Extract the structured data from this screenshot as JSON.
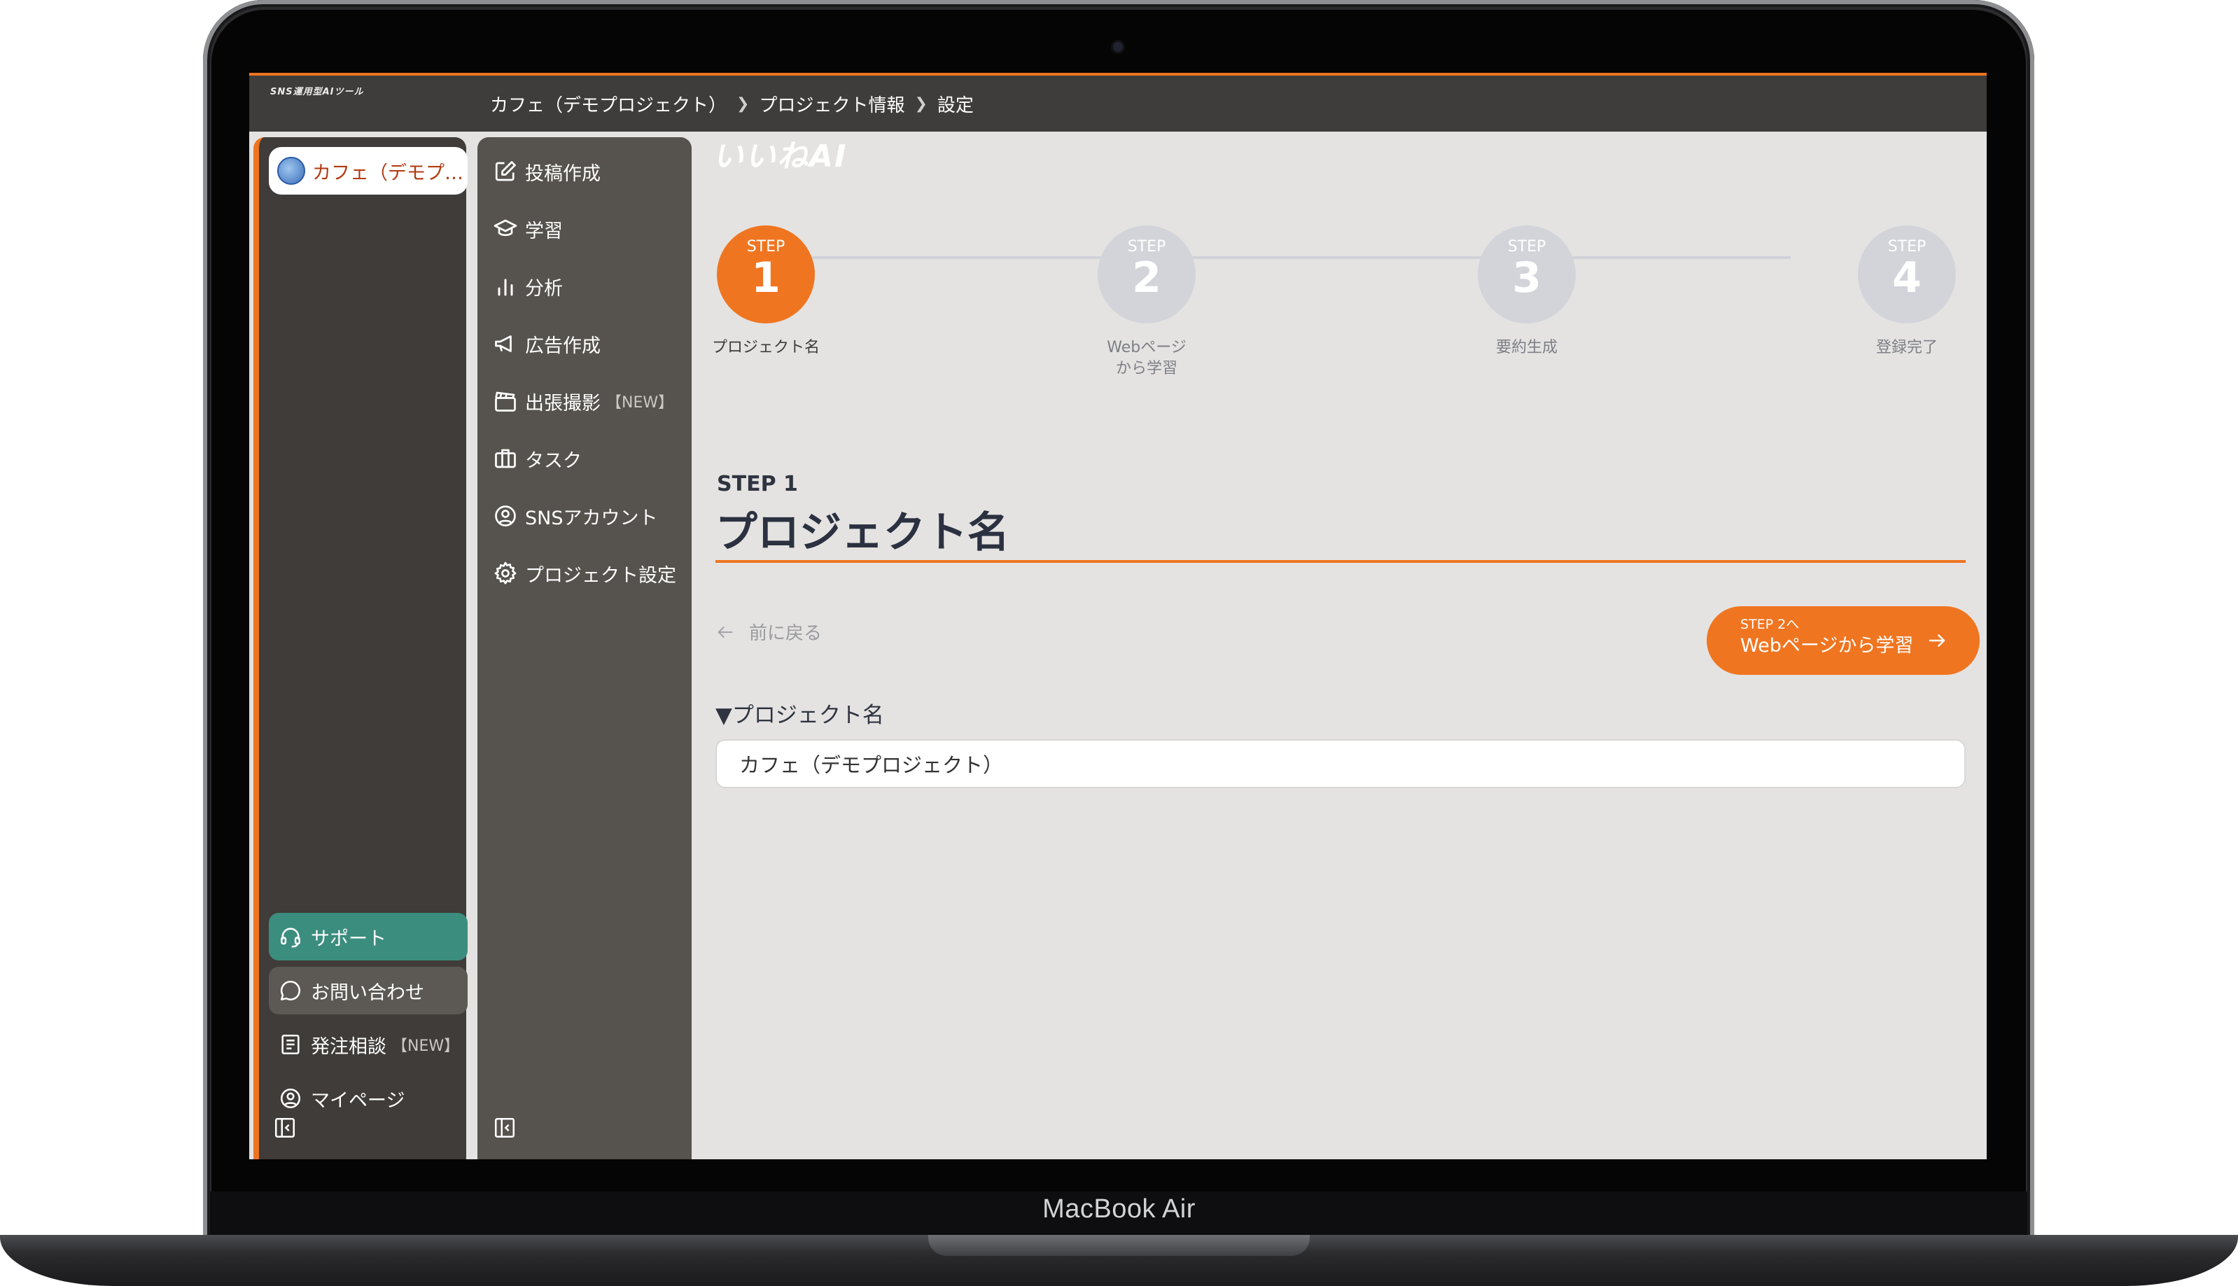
{
  "device": {
    "brand_label": "MacBook Air"
  },
  "app": {
    "logo_tagline": "SNS運用型AIツール",
    "logo_text": "いいねAI",
    "breadcrumb": [
      "カフェ（デモプロジェクト）",
      "プロジェクト情報",
      "設定"
    ]
  },
  "sidebar": {
    "project_chip_label": "カフェ（デモプ…",
    "bottom_items": [
      {
        "label": "サポート",
        "icon": "headset-icon"
      },
      {
        "label": "お問い合わせ",
        "icon": "chat-bubble-icon"
      },
      {
        "label": "発注相談",
        "tag": "【NEW】",
        "icon": "document-icon"
      },
      {
        "label": "マイページ",
        "icon": "user-circle-icon"
      }
    ]
  },
  "nav2": {
    "items": [
      {
        "label": "投稿作成",
        "icon": "edit-icon"
      },
      {
        "label": "学習",
        "icon": "graduation-cap-icon"
      },
      {
        "label": "分析",
        "icon": "bar-chart-icon"
      },
      {
        "label": "広告作成",
        "icon": "megaphone-icon"
      },
      {
        "label": "出張撮影",
        "tag": "【NEW】",
        "icon": "clapperboard-icon"
      },
      {
        "label": "タスク",
        "icon": "briefcase-icon"
      },
      {
        "label": "SNSアカウント",
        "icon": "user-circle-icon"
      },
      {
        "label": "プロジェクト設定",
        "icon": "gear-icon"
      }
    ]
  },
  "stepper": {
    "steps": [
      {
        "label": "STEP",
        "number": "1",
        "name": "プロジェクト名",
        "active": true
      },
      {
        "label": "STEP",
        "number": "2",
        "name": "Webページ\nから学習",
        "active": false
      },
      {
        "label": "STEP",
        "number": "3",
        "name": "要約生成",
        "active": false
      },
      {
        "label": "STEP",
        "number": "4",
        "name": "登録完了",
        "active": false
      }
    ]
  },
  "content": {
    "step_heading": "STEP 1",
    "title": "プロジェクト名",
    "back_label": "前に戻る",
    "next_small": "STEP 2へ",
    "next_big": "Webページから学習",
    "field_label": "▼プロジェクト名",
    "field_value": "カフェ（デモプロジェクト）"
  },
  "colors": {
    "accent": "#ef7420",
    "support": "#3b8d7e",
    "sidebar": "#3f3c39",
    "nav": "#56524d"
  }
}
